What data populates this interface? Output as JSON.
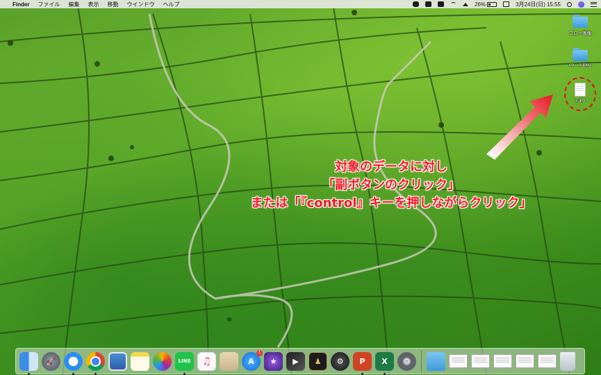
{
  "menubar": {
    "app_name": "Finder",
    "menus": [
      "ファイル",
      "編集",
      "表示",
      "移動",
      "ウインドウ",
      "ヘルプ"
    ],
    "battery_text": "26%",
    "battery_level": 0.26,
    "datetime": "3月24日(日)  15:55"
  },
  "desktop_icons": [
    {
      "label": "ブロー画像",
      "icon": "folder-icon"
    },
    {
      "label": "co....s.jpeg",
      "icon": "folder-icon"
    },
    {
      "label": "2.jpg",
      "icon": "jpg-file-icon"
    }
  ],
  "annotation": {
    "line1": "対象のデータに対し",
    "line2": "「副ボタンのクリック」",
    "line3": "または「『control』キーを押しながらクリック」"
  },
  "dock": {
    "items": [
      {
        "name": "finder-icon",
        "glyph": ""
      },
      {
        "name": "launchpad-icon",
        "glyph": "🚀"
      },
      {
        "name": "safari-icon",
        "glyph": ""
      },
      {
        "name": "chrome-icon",
        "glyph": ""
      },
      {
        "name": "preview-icon",
        "glyph": ""
      },
      {
        "name": "notes-icon",
        "glyph": ""
      },
      {
        "name": "photos-icon",
        "glyph": ""
      },
      {
        "name": "line-icon",
        "glyph": "LINE"
      },
      {
        "name": "music-icon",
        "glyph": "♫"
      },
      {
        "name": "archive-icon",
        "glyph": ""
      },
      {
        "name": "app-store-icon",
        "glyph": "A",
        "badge": "1"
      },
      {
        "name": "imovie-icon",
        "glyph": "★"
      },
      {
        "name": "final-cut-icon",
        "glyph": "▶"
      },
      {
        "name": "figure-app-icon",
        "glyph": "♟"
      },
      {
        "name": "utility-icon",
        "glyph": "⚙"
      },
      {
        "name": "powerpoint-icon",
        "glyph": "P"
      },
      {
        "name": "excel-icon",
        "glyph": "X"
      },
      {
        "name": "system-preferences-icon",
        "glyph": "⚙"
      }
    ],
    "stack_items": [
      {
        "name": "downloads-folder-icon"
      },
      {
        "name": "document-thumbnail-icon"
      },
      {
        "name": "document-thumbnail-icon"
      },
      {
        "name": "document-thumbnail-icon"
      },
      {
        "name": "document-thumbnail-icon"
      },
      {
        "name": "document-thumbnail-icon"
      },
      {
        "name": "trash-icon"
      }
    ]
  },
  "colors": {
    "annotation_text": "#ff1420",
    "highlight_circle": "#d8141c",
    "arrow": "#e8242c"
  }
}
